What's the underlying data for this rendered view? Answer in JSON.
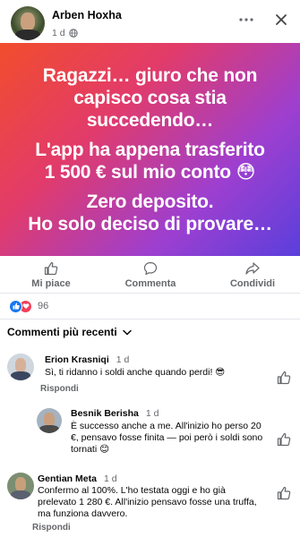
{
  "post": {
    "author": "Arben Hoxha",
    "time": "1 d",
    "text_lines": [
      "Ragazzi… giuro che non",
      "capisco cosa stia",
      "succedendo…",
      "L'app ha appena trasferito",
      "1 500 € sul mio conto 😳",
      "Zero deposito.",
      "Ho solo deciso di provare…"
    ]
  },
  "actions": {
    "like": "Mi piace",
    "comment": "Commenta",
    "share": "Condividi"
  },
  "reactions": {
    "count": "96"
  },
  "comments_sort": "Commenti più recenti",
  "comments": [
    {
      "name": "Erion Krasniqi",
      "time": "1 d",
      "text": "Sì, ti ridanno i soldi anche quando perdi! 😎",
      "reply": "Rispondi"
    },
    {
      "name": "Besnik Berisha",
      "time": "1 d",
      "text": "È successo anche a me. All'inizio ho perso 20 €, pensavo fosse finita — poi però i soldi sono tornati 😊"
    },
    {
      "name": "Gentian Meta",
      "time": "1 d",
      "text": "Confermo al 100%. L'ho testata oggi e ho già prelevato 1 280 €. All'inizio pensavo fosse una truffa, ma funziona davvero.",
      "reply": "Rispondi"
    }
  ],
  "colors": {
    "gradient": [
      "#f24d2c",
      "#e23b6a",
      "#9d3fd0",
      "#5a3fdc"
    ],
    "like_blue": "#1877f2",
    "love_red": "#f33e58",
    "secondary_text": "#65676b"
  },
  "icons": [
    "more-icon",
    "close-icon",
    "globe-icon",
    "like-icon",
    "comment-icon",
    "share-icon",
    "chevron-down-icon",
    "comment-like-icon"
  ]
}
